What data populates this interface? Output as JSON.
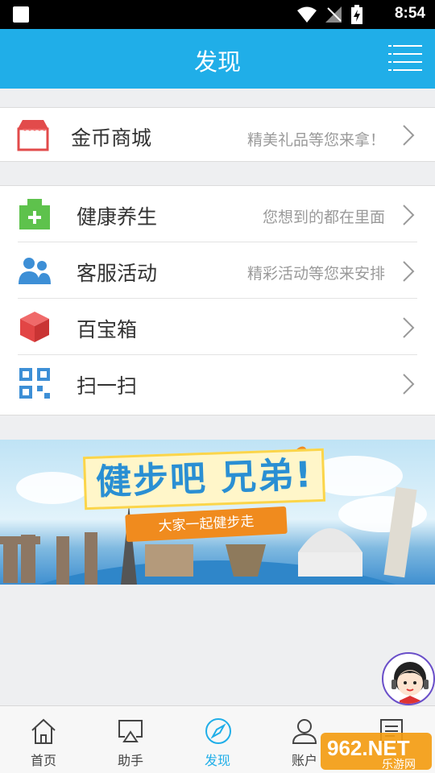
{
  "status_bar": {
    "time": "8:54"
  },
  "header": {
    "title": "发现"
  },
  "sections": [
    {
      "rows": [
        {
          "label": "金币商城",
          "hint": "精美礼品等您来拿！",
          "icon": "shop-icon"
        }
      ]
    },
    {
      "rows": [
        {
          "label": "健康养生",
          "hint": "您想到的都在里面",
          "icon": "health-box-icon"
        },
        {
          "label": "客服活动",
          "hint": "精彩活动等您来安排",
          "icon": "people-icon"
        },
        {
          "label": "百宝箱",
          "hint": "",
          "icon": "cube-icon"
        },
        {
          "label": "扫一扫",
          "hint": "",
          "icon": "qr-scan-icon"
        }
      ]
    }
  ],
  "banner": {
    "slogan": "健步吧 兄弟!",
    "subtitle": "大家一起健步走"
  },
  "nav": {
    "tabs": [
      {
        "label": "首页",
        "icon": "home-icon"
      },
      {
        "label": "助手",
        "icon": "cast-icon"
      },
      {
        "label": "发现",
        "icon": "compass-icon",
        "active": true
      },
      {
        "label": "账户",
        "icon": "user-icon"
      },
      {
        "label": "",
        "icon": "document-icon"
      }
    ]
  },
  "watermark": {
    "text": "962.NET",
    "subtext": "乐游网"
  },
  "colors": {
    "accent": "#20aee8",
    "background": "#eeeff1"
  }
}
